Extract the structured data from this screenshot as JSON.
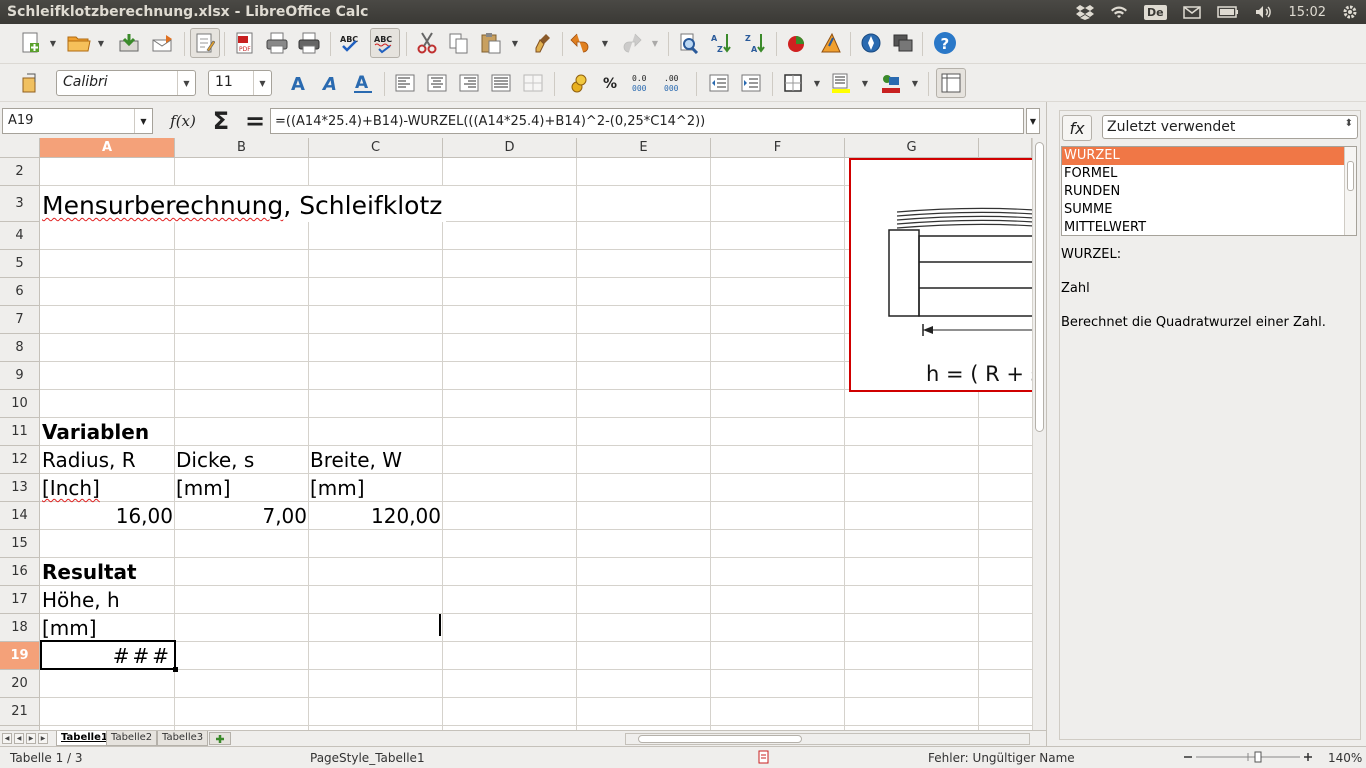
{
  "window": {
    "title": "Schleifklotzberechnung.xlsx - LibreOffice Calc"
  },
  "tray": {
    "keyboard_layout": "De",
    "time": "15:02"
  },
  "toolbar2": {
    "font_name": "Calibri",
    "font_size": "11"
  },
  "formula_bar": {
    "name_box": "A19",
    "formula": "=((A14*25.4)+B14)-WURZEL(((A14*25.4)+B14)^2-(0,25*C14^2))",
    "fx_label": "f(x)",
    "sum_label": "Σ",
    "equals_label": "="
  },
  "columns": [
    "A",
    "B",
    "C",
    "D",
    "E",
    "F",
    "G"
  ],
  "rows": [
    "2",
    "3",
    "4",
    "5",
    "6",
    "7",
    "8",
    "9",
    "10",
    "11",
    "12",
    "13",
    "14",
    "15",
    "16",
    "17",
    "18",
    "19",
    "20",
    "21"
  ],
  "cells": {
    "A3": "Mensurberechnung, Schleifklotz",
    "A11": "Variablen",
    "A12": "Radius, R",
    "B12": "Dicke, s",
    "C12": "Breite, W",
    "A13": "[Inch]",
    "B13": "[mm]",
    "C13": "[mm]",
    "A14": "16,00",
    "B14": "7,00",
    "C14": "120,00",
    "A16": "Resultat",
    "A17": "Höhe, h",
    "A18": "[mm]",
    "A19": "###"
  },
  "picture": {
    "formula_text": "h = ( R + s"
  },
  "sheet_tabs": [
    {
      "label": "Tabelle1",
      "active": true
    },
    {
      "label": "Tabelle2",
      "active": false
    },
    {
      "label": "Tabelle3",
      "active": false
    }
  ],
  "status": {
    "sheet": "Tabelle 1 / 3",
    "page_style": "PageStyle_Tabelle1",
    "error": "Fehler: Ungültiger Name",
    "zoom": "140%"
  },
  "sidebar": {
    "fx_button": "fx",
    "category": "Zuletzt verwendet",
    "functions": [
      "WURZEL",
      "FORMEL",
      "RUNDEN",
      "SUMME",
      "MITTELWERT"
    ],
    "selected_function": "WURZEL",
    "desc_name": "WURZEL:",
    "desc_arg": "Zahl",
    "desc_text": "Berechnet die Quadratwurzel einer Zahl."
  },
  "colors": {
    "selection_header": "#f4a179",
    "list_selection": "#f07746",
    "picture_border": "#d00000"
  }
}
